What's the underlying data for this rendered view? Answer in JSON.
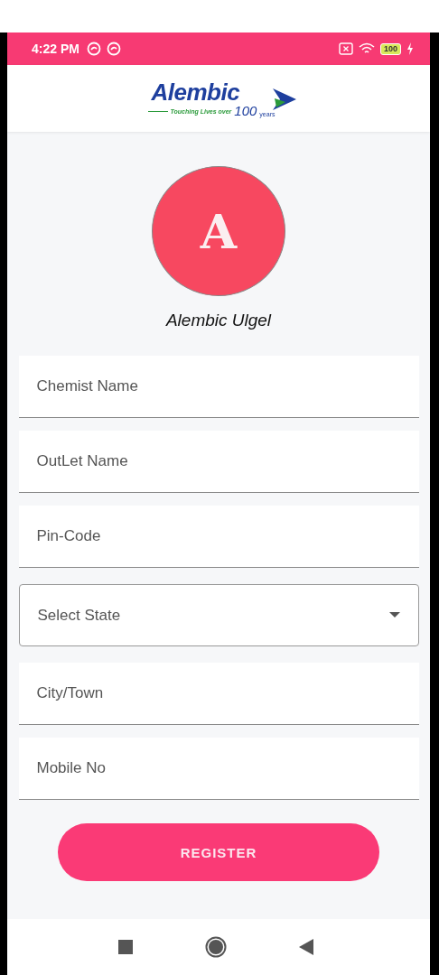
{
  "status_bar": {
    "time": "4:22 PM",
    "battery": "100"
  },
  "header": {
    "logo": {
      "wordmark": "Alembic",
      "tagline": "Touching Lives over",
      "number": "100",
      "unit": "years"
    }
  },
  "profile": {
    "initial": "A",
    "name": "Alembic Ulgel"
  },
  "fields": [
    {
      "kind": "text",
      "placeholder": "Chemist Name"
    },
    {
      "kind": "text",
      "placeholder": "OutLet Name"
    },
    {
      "kind": "text",
      "placeholder": "Pin-Code"
    },
    {
      "kind": "select",
      "placeholder": "Select State"
    },
    {
      "kind": "text",
      "placeholder": "City/Town"
    },
    {
      "kind": "text",
      "placeholder": "Mobile No"
    }
  ],
  "register_button": "REGISTER"
}
